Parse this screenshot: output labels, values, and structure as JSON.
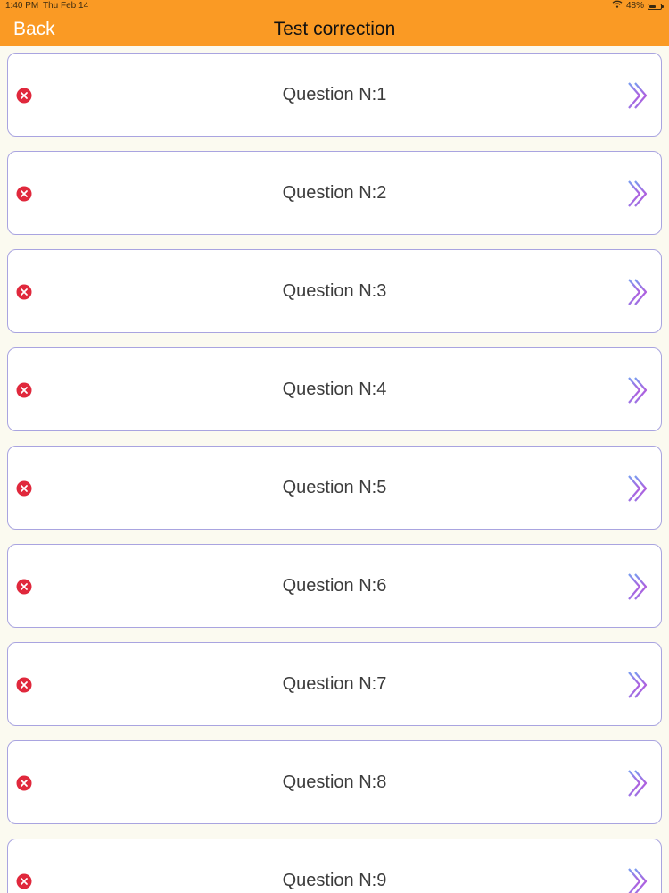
{
  "statusbar": {
    "time": "1:40 PM",
    "date": "Thu Feb 14",
    "battery": "48%"
  },
  "navbar": {
    "back_label": "Back",
    "title": "Test correction",
    "color": "#fa9a24"
  },
  "questions": [
    {
      "label": "Question N:1",
      "status": "incorrect"
    },
    {
      "label": "Question N:2",
      "status": "incorrect"
    },
    {
      "label": "Question N:3",
      "status": "incorrect"
    },
    {
      "label": "Question N:4",
      "status": "incorrect"
    },
    {
      "label": "Question N:5",
      "status": "incorrect"
    },
    {
      "label": "Question N:6",
      "status": "incorrect"
    },
    {
      "label": "Question N:7",
      "status": "incorrect"
    },
    {
      "label": "Question N:8",
      "status": "incorrect"
    },
    {
      "label": "Question N:9",
      "status": "incorrect"
    }
  ],
  "icons": {
    "status": "x-circle-icon",
    "chevron": "double-chevron-right-icon"
  }
}
